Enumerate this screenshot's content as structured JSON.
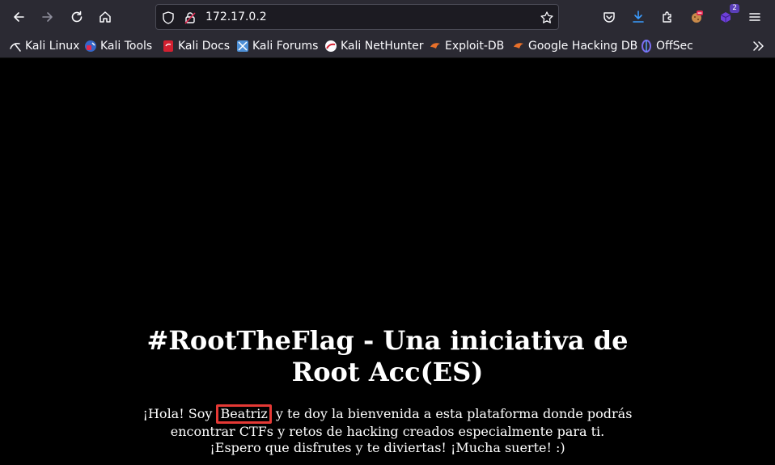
{
  "toolbar": {
    "back_icon": "arrow-left-icon",
    "forward_icon": "arrow-right-icon",
    "reload_icon": "reload-icon",
    "home_icon": "home-icon",
    "url": "172.17.0.2",
    "downloads_badge": "2",
    "menu_icon": "hamburger-menu-icon"
  },
  "bookmarks": [
    {
      "label": "Kali Linux",
      "icon": "kali-dragon-icon"
    },
    {
      "label": "Kali Tools",
      "icon": "kali-tools-icon"
    },
    {
      "label": "Kali Docs",
      "icon": "kali-docs-icon"
    },
    {
      "label": "Kali Forums",
      "icon": "kali-forums-icon"
    },
    {
      "label": "Kali NetHunter",
      "icon": "kali-nethunter-icon"
    },
    {
      "label": "Exploit-DB",
      "icon": "exploit-db-icon"
    },
    {
      "label": "Google Hacking DB",
      "icon": "ghdb-icon"
    },
    {
      "label": "OffSec",
      "icon": "offsec-icon"
    }
  ],
  "page": {
    "headline_line1": "#RootTheFlag - Una iniciativa de",
    "headline_line2": "Root Acc(ES)",
    "intro_before_name": "¡Hola! Soy ",
    "intro_name": "Beatriz",
    "intro_after_name": " y te doy la bienvenida a esta plataforma donde podrás",
    "intro_line2": "encontrar CTFs y retos de hacking creados especialmente para ti.",
    "intro_line3": "¡Espero que disfrutes y te diviertas! ¡Mucha suerte! :)"
  },
  "colors": {
    "toolbar_bg": "#2b2a33",
    "page_bg": "#000000",
    "highlight": "#e53935"
  }
}
